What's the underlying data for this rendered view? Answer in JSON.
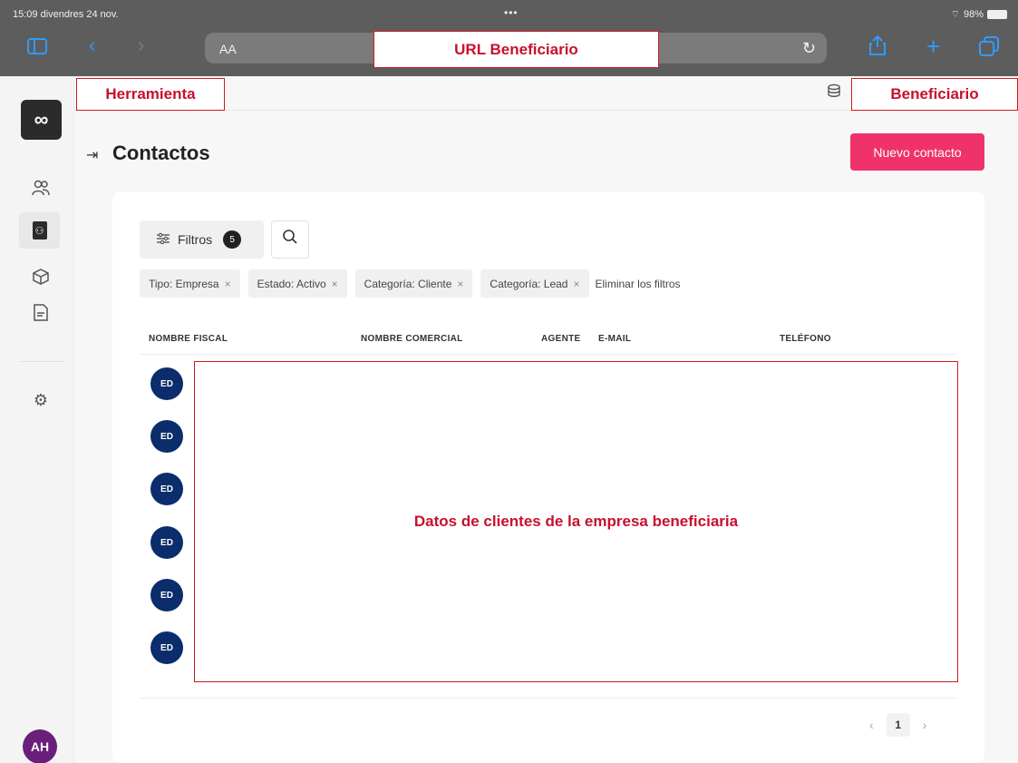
{
  "status_bar": {
    "time_date": "15:09  divendres 24 nov.",
    "dots": "•••",
    "battery": "98%"
  },
  "browser": {
    "aa_label": "AA",
    "url_annotation": "URL Beneficiario"
  },
  "annotations": {
    "tool": "Herramienta",
    "beneficiary": "Beneficiario",
    "data": "Datos de clientes de la empresa beneficiaria"
  },
  "sidebar": {
    "logo": "∞",
    "user_initials": "AH"
  },
  "page": {
    "title": "Contactos",
    "new_contact_label": "Nuevo contacto"
  },
  "filters": {
    "label": "Filtros",
    "count": "5",
    "chips": [
      "Tipo: Empresa",
      "Estado: Activo",
      "Categoría: Cliente",
      "Categoría: Lead"
    ],
    "clear_label": "Eliminar los filtros"
  },
  "table": {
    "columns": [
      "NOMBRE FISCAL",
      "NOMBRE COMERCIAL",
      "AGENTE",
      "E-MAIL",
      "TELÉFONO"
    ],
    "row_avatars": [
      "ED",
      "ED",
      "ED",
      "ED",
      "ED",
      "ED"
    ]
  },
  "pagination": {
    "current_page": "1"
  },
  "colors": {
    "accent": "#f0326b",
    "annotation": "#c8102e",
    "avatar": "#0c2d6b",
    "safari_blue": "#2f9bff"
  }
}
